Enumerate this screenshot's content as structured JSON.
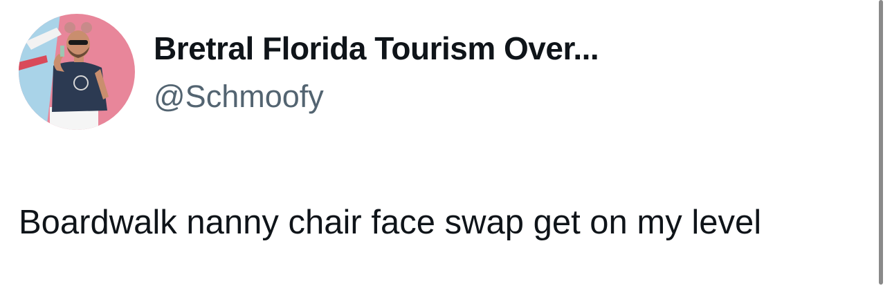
{
  "author": {
    "display_name": "Bretral Florida Tourism Over...",
    "handle": "@Schmoofy",
    "avatar_icon": "profile-photo"
  },
  "tweet": {
    "text": "Boardwalk nanny chair face swap get on my level"
  },
  "colors": {
    "text_primary": "#0f1419",
    "text_secondary": "#536471",
    "background": "#ffffff"
  }
}
